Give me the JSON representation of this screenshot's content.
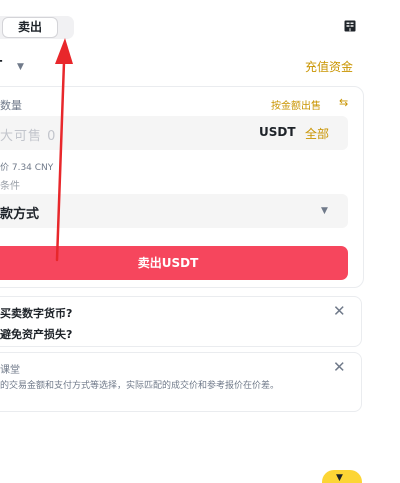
{
  "segment": {
    "sell_label": "卖出"
  },
  "header": {
    "coin": "T",
    "topup_label": "充值资金"
  },
  "form": {
    "quantity_label": "数量",
    "by_amount_label": "按金额出售",
    "quantity_placeholder": "大可售 0",
    "unit": "USDT",
    "all_label": "全部",
    "price_ref": "价 7.34 CNY",
    "conditions_label": "条件",
    "payment_method": "款方式",
    "sell_button": "卖出USDT"
  },
  "faq": {
    "q1": "买卖数字货币?",
    "q2": "避免资产损失?"
  },
  "classroom": {
    "title": "课堂",
    "body": "的交易金额和支付方式等选择，实际匹配的成交价和参考报价在价差。"
  },
  "colors": {
    "accent": "#c99400",
    "sell": "#f6465d",
    "float": "#fcd535",
    "arrow": "#e8272b"
  },
  "icons": [
    "book-icon",
    "chevron-down-icon",
    "swap-icon",
    "close-icon",
    "annotation-arrow"
  ]
}
